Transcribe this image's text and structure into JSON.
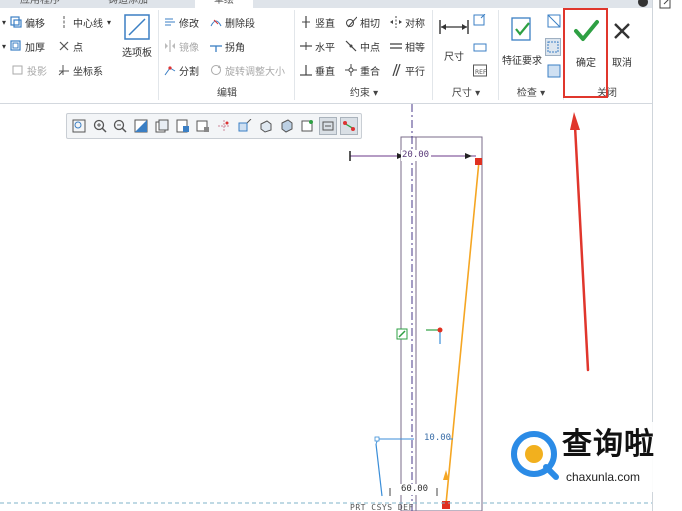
{
  "tabs": [
    "应用程序",
    "铸造添加",
    "草绘"
  ],
  "ribbon": {
    "col1": {
      "offset": "偏移",
      "thicken": "加厚",
      "project": "投影"
    },
    "col2": {
      "centerline": "中心线",
      "point": "点",
      "coord_sys": "坐标系"
    },
    "palette": "选项板",
    "edit": {
      "modify": "修改",
      "delete_segment": "删除段",
      "mirror": "镜像",
      "corner": "拐角",
      "divide": "分割",
      "rotate_resize": "旋转调整大小",
      "group_label": "编辑"
    },
    "constraints": {
      "vertical": "竖直",
      "tangent": "相切",
      "symmetric": "对称",
      "horizontal": "水平",
      "midpoint": "中点",
      "equal": "相等",
      "perpendicular": "垂直",
      "coincident": "重合",
      "parallel": "平行",
      "group_label": "约束 ▾"
    },
    "dimension": {
      "label": "尺寸",
      "group_label": "尺寸 ▾"
    },
    "inspect": {
      "feature_requirements": "特征要求",
      "group_label": "检查 ▾"
    },
    "close": {
      "ok": "确定",
      "cancel": "取消",
      "group_label": "关闭"
    }
  },
  "sketch": {
    "dim_top": "20.00",
    "dim_mid": "10.00",
    "dim_bottom": "60.00",
    "csys_label": "PRT_CSYS_DEF"
  },
  "watermark": {
    "title": "查询啦",
    "url": "chaxunla.com"
  },
  "colors": {
    "ok_check": "#2ea043",
    "annotation": "#e0362c",
    "sketch_orange": "#f5a623",
    "dimension": "#6b3a8a",
    "construction": "#3b8ed8"
  }
}
